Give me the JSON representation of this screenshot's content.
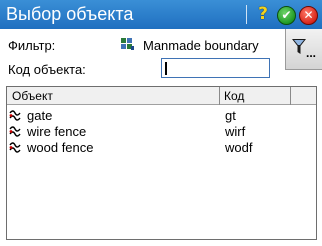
{
  "window": {
    "title": "Выбор объекта"
  },
  "titlebar_buttons": {
    "help_icon": "question-mark-icon",
    "help_glyph": "?",
    "ok_icon": "check-icon",
    "ok_glyph": "✔",
    "close_icon": "close-icon",
    "close_glyph": "✕"
  },
  "form": {
    "filter_label": "Фильтр:",
    "filter_value": "Manmade boundary",
    "filter_icon": "layer-grid-icon",
    "code_label": "Код объекта:",
    "code_value": ""
  },
  "filter_button": {
    "icon": "funnel-icon",
    "dots": "..."
  },
  "list": {
    "columns": [
      "Объект",
      "Код"
    ],
    "rows": [
      {
        "name": "gate",
        "code": "gt",
        "icon": "line-feature-icon"
      },
      {
        "name": "wire fence",
        "code": "wirf",
        "icon": "line-feature-icon"
      },
      {
        "name": "wood fence",
        "code": "wodf",
        "icon": "line-feature-icon"
      }
    ]
  },
  "colors": {
    "titlebar": "#1f6fc0",
    "input_border": "#3f73b5"
  }
}
